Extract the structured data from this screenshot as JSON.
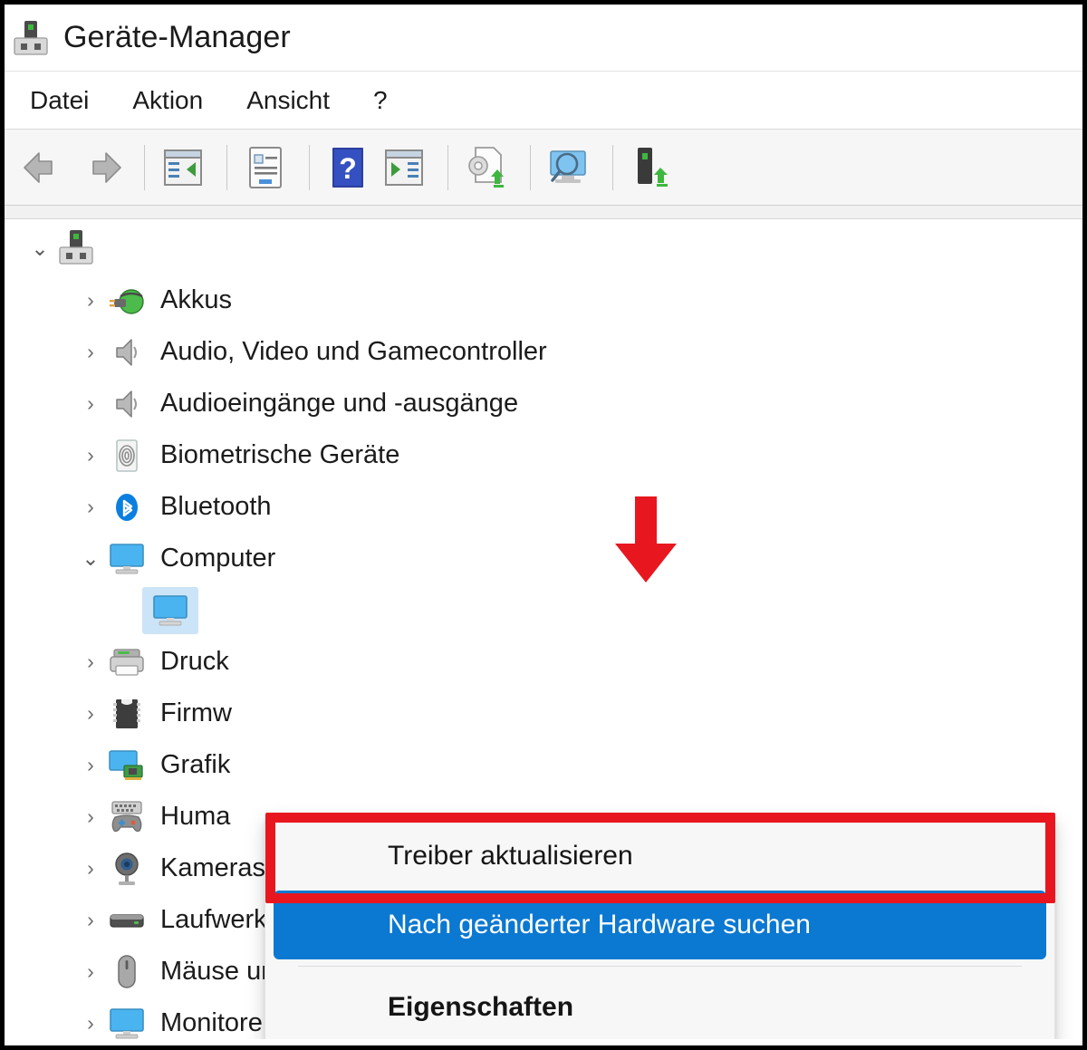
{
  "window": {
    "title": "Geräte-Manager",
    "title_icon": "device-manager-icon"
  },
  "menubar": {
    "items": [
      {
        "label": "Datei",
        "name": "menu-datei"
      },
      {
        "label": "Aktion",
        "name": "menu-aktion"
      },
      {
        "label": "Ansicht",
        "name": "menu-ansicht"
      },
      {
        "label": "?",
        "name": "menu-hilfe"
      }
    ]
  },
  "toolbar": {
    "buttons": [
      {
        "name": "back-arrow-icon"
      },
      {
        "name": "forward-arrow-icon"
      },
      {
        "name": "show-hide-console-tree-icon"
      },
      {
        "name": "properties-icon"
      },
      {
        "name": "help-icon"
      },
      {
        "name": "update-driver-window-icon"
      },
      {
        "name": "scan-for-hardware-changes-icon"
      },
      {
        "name": "show-hidden-devices-icon"
      },
      {
        "name": "device-install-icon"
      }
    ]
  },
  "tree": {
    "root": {
      "icon": "computer-root-icon",
      "expanded": true,
      "chevron": "chevron-down"
    },
    "items": [
      {
        "label": "Akkus",
        "icon": "battery-icon",
        "chevron": "chevron-right",
        "level": 1,
        "selected": false
      },
      {
        "label": "Audio, Video und Gamecontroller",
        "icon": "speaker-icon",
        "chevron": "chevron-right",
        "level": 1,
        "selected": false
      },
      {
        "label": "Audioeingänge und -ausgänge",
        "icon": "speaker-icon",
        "chevron": "chevron-right",
        "level": 1,
        "selected": false
      },
      {
        "label": "Biometrische Geräte",
        "icon": "fingerprint-icon",
        "chevron": "chevron-right",
        "level": 1,
        "selected": false
      },
      {
        "label": "Bluetooth",
        "icon": "bluetooth-icon",
        "chevron": "chevron-right",
        "level": 1,
        "selected": false
      },
      {
        "label": "Computer",
        "icon": "monitor-icon",
        "chevron": "chevron-down",
        "level": 1,
        "selected": false
      },
      {
        "label": "",
        "icon": "monitor-device-icon",
        "chevron": "",
        "level": 2,
        "selected": true
      },
      {
        "label": "Druck",
        "icon": "printer-icon",
        "chevron": "chevron-right",
        "level": 1,
        "selected": false
      },
      {
        "label": "Firmw",
        "icon": "firmware-chip-icon",
        "chevron": "chevron-right",
        "level": 1,
        "selected": false
      },
      {
        "label": "Grafik",
        "icon": "graphics-card-icon",
        "chevron": "chevron-right",
        "level": 1,
        "selected": false
      },
      {
        "label": "Huma",
        "icon": "hid-gamepad-icon",
        "chevron": "chevron-right",
        "level": 1,
        "selected": false
      },
      {
        "label": "Kameras",
        "icon": "camera-icon",
        "chevron": "chevron-right",
        "level": 1,
        "selected": false
      },
      {
        "label": "Laufwerke",
        "icon": "drive-icon",
        "chevron": "chevron-right",
        "level": 1,
        "selected": false
      },
      {
        "label": "Mäuse und andere Zeigegeräte",
        "icon": "mouse-icon",
        "chevron": "chevron-right",
        "level": 1,
        "selected": false
      },
      {
        "label": "Monitore",
        "icon": "display-icon",
        "chevron": "chevron-right",
        "level": 1,
        "selected": false
      }
    ]
  },
  "context_menu": {
    "items": [
      {
        "label": "Treiber aktualisieren",
        "name": "ctx-update-driver",
        "highlighted": false,
        "bold": false
      },
      {
        "label": "Nach geänderter Hardware suchen",
        "name": "ctx-scan-hardware-changes",
        "highlighted": true,
        "bold": false
      },
      {
        "label": "Eigenschaften",
        "name": "ctx-properties",
        "highlighted": false,
        "bold": true
      }
    ]
  },
  "annotations": {
    "highlight_box_color": "#e8171f",
    "arrow_color": "#e8171f",
    "highlight_target": "Treiber aktualisieren"
  },
  "colors": {
    "menu_highlight_blue": "#0b78d1",
    "selection_blue": "#cce4f7",
    "toolbar_bg": "#f6f6f6",
    "menu_bg": "#f7f7f7",
    "text": "#1b1b1b"
  }
}
